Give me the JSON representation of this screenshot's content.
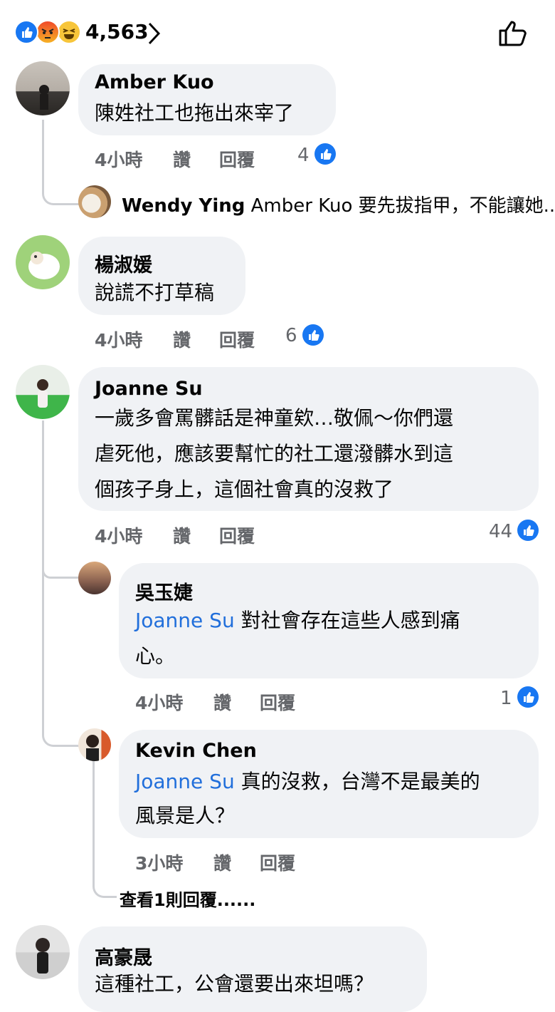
{
  "reactions": {
    "count": "4,563",
    "icons": [
      "like-icon",
      "angry-icon",
      "haha-icon"
    ],
    "accent": "#1877f2"
  },
  "comments": [
    {
      "name": "Amber Kuo",
      "lines": [
        "陳姓社工也拖出來宰了"
      ],
      "time": "4小時",
      "like": "讚",
      "reply": "回覆",
      "likes": "4",
      "inline_reply": {
        "name": "Wendy Ying",
        "text": "Amber Kuo 要先拔指甲，不能讓她..."
      }
    },
    {
      "name": "楊淑媛",
      "lines": [
        "說謊不打草稿"
      ],
      "time": "4小時",
      "like": "讚",
      "reply": "回覆",
      "likes": "6"
    },
    {
      "name": "Joanne Su",
      "lines": [
        "一歲多會罵髒話是神童欸…敬佩～你們還",
        "虐死他，應該要幫忙的社工還潑髒水到這",
        "個孩子身上，這個社會真的沒救了"
      ],
      "time": "4小時",
      "like": "讚",
      "reply": "回覆",
      "likes": "44",
      "replies": [
        {
          "name": "吳玉婕",
          "mention": "Joanne Su",
          "line1": " 對社會存在這些人感到痛",
          "line2": "心。",
          "time": "4小時",
          "like": "讚",
          "reply": "回覆",
          "likes": "1"
        },
        {
          "name": "Kevin Chen",
          "mention": "Joanne Su",
          "line1": " 真的沒救，台灣不是最美的",
          "line2": "風景是人？",
          "time": "3小時",
          "like": "讚",
          "reply": "回覆"
        }
      ],
      "view_more": "查看1則回覆......"
    },
    {
      "name": "高豪晟",
      "lines": [
        "這種社工，公會還要出來坦嗎？"
      ]
    }
  ]
}
